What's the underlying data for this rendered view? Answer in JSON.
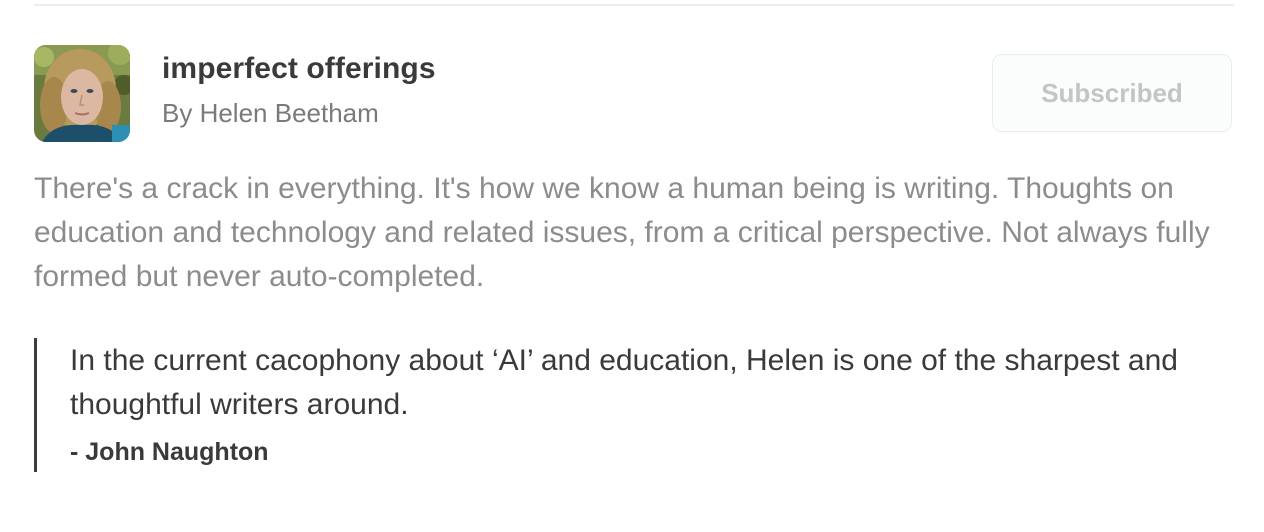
{
  "publication": {
    "title": "imperfect offerings",
    "byline": "By Helen Beetham",
    "avatar_icon": "author-photo",
    "description": "There's a crack in everything. It's how we know a human being is writing. Thoughts on education and technology and related issues, from a critical perspective. Not always fully formed but never auto-completed."
  },
  "subscribe": {
    "label": "Subscribed",
    "state": "subscribed"
  },
  "testimonial": {
    "quote": "In the current cacophony about ‘AI’ and education, Helen is one of the sharpest and thoughtful writers around.",
    "author": "- John Naughton"
  },
  "colors": {
    "title_text": "#3a3a3a",
    "muted_text": "#8c8c8c",
    "button_text": "#c2c4c5",
    "button_border": "#e4eef3",
    "quote_bar": "#3d3d3d"
  }
}
